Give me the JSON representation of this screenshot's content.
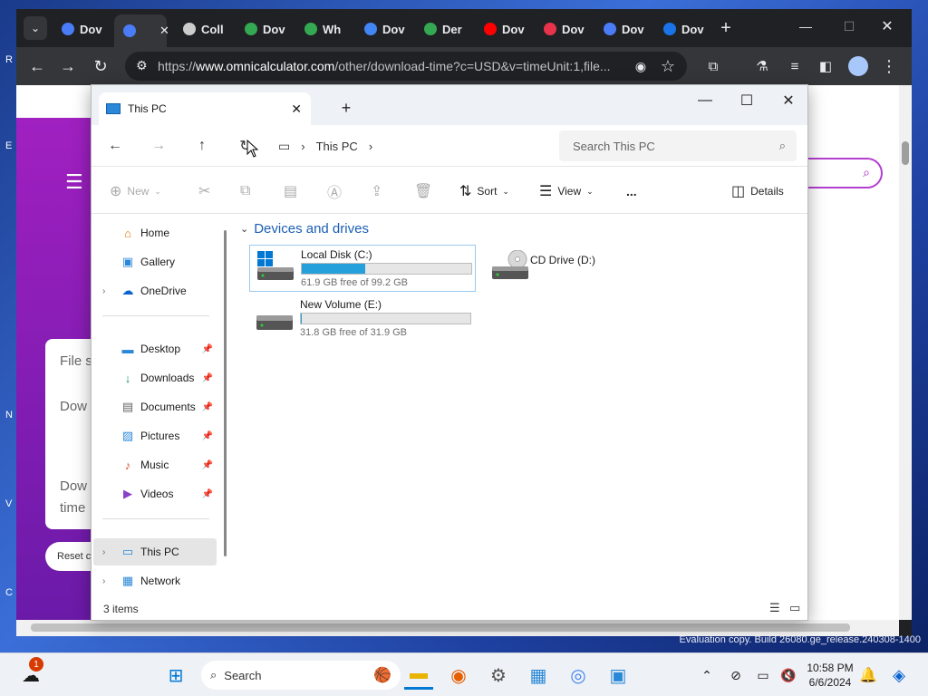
{
  "browser": {
    "tabs": [
      {
        "label": "Dov",
        "color": "#4a7cf7"
      },
      {
        "label": "",
        "color": "#4a7cf7"
      },
      {
        "label": "Coll",
        "color": "#cccccc"
      },
      {
        "label": "Dov",
        "color": "#34a853"
      },
      {
        "label": "Wh",
        "color": "#34a853"
      },
      {
        "label": "Dov",
        "color": "#4285f4"
      },
      {
        "label": "Der",
        "color": "#34a853"
      },
      {
        "label": "Dov",
        "color": "#ff0000"
      },
      {
        "label": "Dov",
        "color": "#e8334a"
      },
      {
        "label": "Dov",
        "color": "#4a7cf7"
      },
      {
        "label": "Dov",
        "color": "#1a73e8"
      }
    ],
    "url_prefix": "https://",
    "url_host": "www.omnicalculator.com",
    "url_rest": "/other/download-time?c=USD&v=timeUnit:1,file...",
    "page_fragments": {
      "file_label": "File s",
      "dow_label": "Dow",
      "download_time_1": "Dow",
      "download_time_2": "time",
      "reset_button": "Reset c"
    }
  },
  "explorer": {
    "tab_title": "This PC",
    "breadcrumb": "This PC",
    "search_placeholder": "Search This PC",
    "commands": {
      "new": "New",
      "sort": "Sort",
      "view": "View",
      "more": "...",
      "details": "Details"
    },
    "nav": {
      "top": [
        {
          "label": "Home",
          "icon": "home-icon"
        },
        {
          "label": "Gallery",
          "icon": "gallery-icon"
        },
        {
          "label": "OneDrive",
          "icon": "onedrive-icon"
        }
      ],
      "quick": [
        {
          "label": "Desktop",
          "icon": "desktop-folder-icon"
        },
        {
          "label": "Downloads",
          "icon": "downloads-folder-icon"
        },
        {
          "label": "Documents",
          "icon": "documents-folder-icon"
        },
        {
          "label": "Pictures",
          "icon": "pictures-folder-icon"
        },
        {
          "label": "Music",
          "icon": "music-folder-icon"
        },
        {
          "label": "Videos",
          "icon": "videos-folder-icon"
        }
      ],
      "bottom": [
        {
          "label": "This PC",
          "icon": "this-pc-icon"
        },
        {
          "label": "Network",
          "icon": "network-icon"
        }
      ]
    },
    "group_title": "Devices and drives",
    "drives": [
      {
        "name": "Local Disk (C:)",
        "free": "61.9 GB free of 99.2 GB",
        "used_fraction": 0.376
      },
      {
        "name": "CD Drive (D:)"
      },
      {
        "name": "New Volume (E:)",
        "free": "31.8 GB free of 31.9 GB",
        "used_fraction": 0.003
      }
    ],
    "status": "3 items"
  },
  "taskbar": {
    "search_label": "Search",
    "notification_count": "1",
    "time": "10:58 PM",
    "date": "6/6/2024"
  },
  "watermark": {
    "line1": "Evaluation copy. Build 26080.ge_release.240308-1400"
  }
}
